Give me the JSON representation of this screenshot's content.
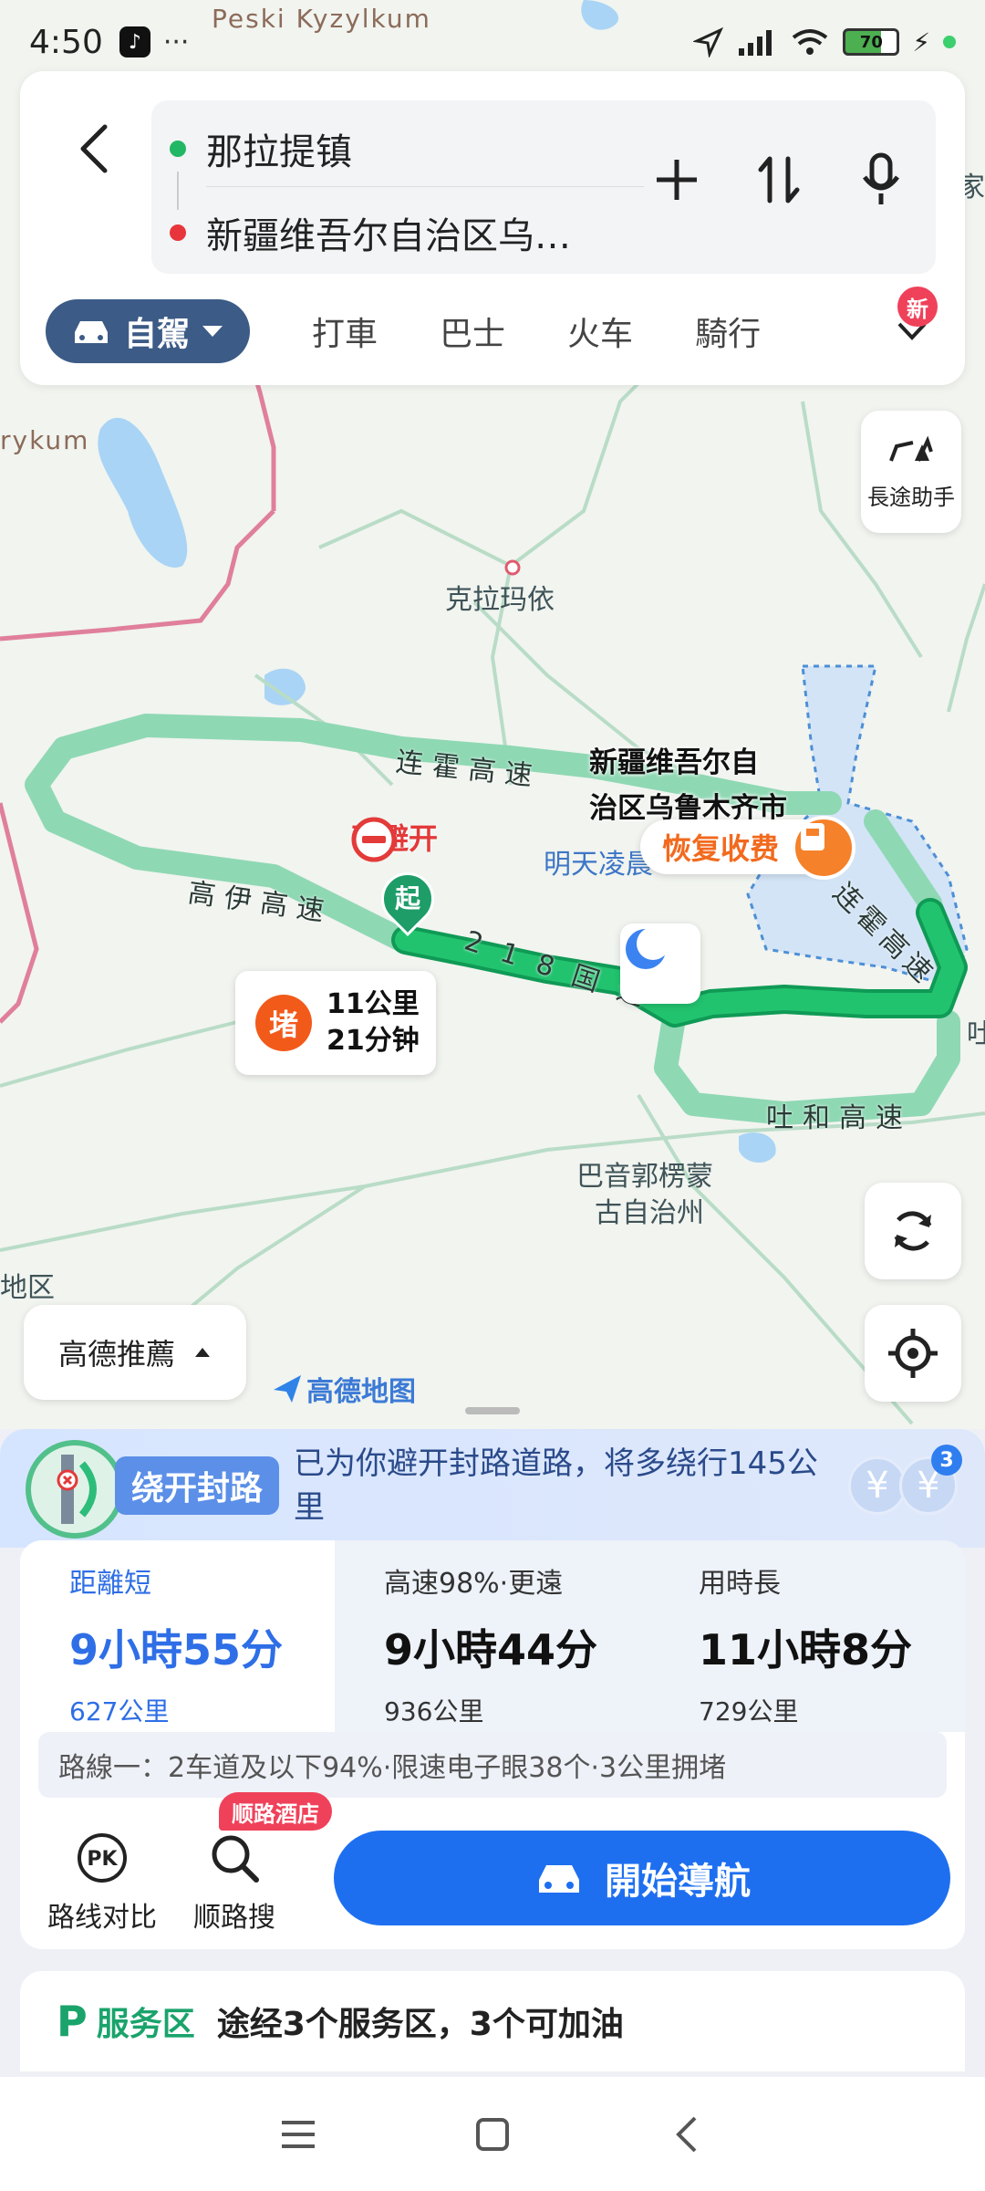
{
  "status_bar": {
    "time": "4:50",
    "dots": "···",
    "battery": "70"
  },
  "search": {
    "origin": "那拉提镇",
    "destination": "新疆维吾尔自治区乌…"
  },
  "modes": {
    "active": "自駕",
    "tabs": [
      "打車",
      "巴士",
      "火车",
      "騎行"
    ],
    "new_badge": "新"
  },
  "map": {
    "labels": {
      "peski": "Peski Kyzylkum",
      "rykum": "rykum",
      "kelamayi": "克拉玛依",
      "bayin_1": "巴音郭楞蒙",
      "bayin_2": "古自治州",
      "diqu": "地区",
      "mingtian": "明天凌晨",
      "tu_edge": "吐",
      "ke_edge": "家"
    },
    "city_1": "新疆维吾尔自",
    "city_2": "治区乌鲁木齐市",
    "roads": {
      "lianhuo_1": "连霍高速",
      "lianhuo_2": "连霍高速",
      "gaoyi": "高伊高速",
      "tuhe": "吐和高速",
      "g218": "218国道"
    },
    "avoided_label": "已避开",
    "toll_label": "恢复收费",
    "start_label": "起",
    "jam": {
      "badge": "堵",
      "distance": "11公里",
      "time": "21分钟"
    },
    "long_trip_label": "長途助手",
    "recommend_label": "高德推薦",
    "logo_text": "高德地图"
  },
  "detour": {
    "chip": "绕开封路",
    "text": "已为你避开封路道路，将多绕行145公里",
    "coin_count": "3"
  },
  "route_options": [
    {
      "tag": "距離短",
      "duration": "9小時55分",
      "distance": "627公里",
      "active": true
    },
    {
      "tag": "高速98%·更遠",
      "duration": "9小時44分",
      "distance": "936公里",
      "active": false
    },
    {
      "tag": "用時長",
      "duration": "11小時8分",
      "distance": "729公里",
      "active": false
    }
  ],
  "route_desc": "路線一：2车道及以下94%·限速电子眼38个·3公里拥堵",
  "actions": {
    "compare": "路线对比",
    "search_along": "顺路搜",
    "hotel_badge": "顺路酒店",
    "start_nav": "開始導航"
  },
  "service": {
    "logo": "P",
    "label": "服务区",
    "desc": "途经3个服务区，3个可加油"
  },
  "colors": {
    "accent": "#1e6ff0",
    "route": "#1fb36b",
    "alt_route": "#8fd8b4",
    "mode_active": "#3c5b86"
  }
}
